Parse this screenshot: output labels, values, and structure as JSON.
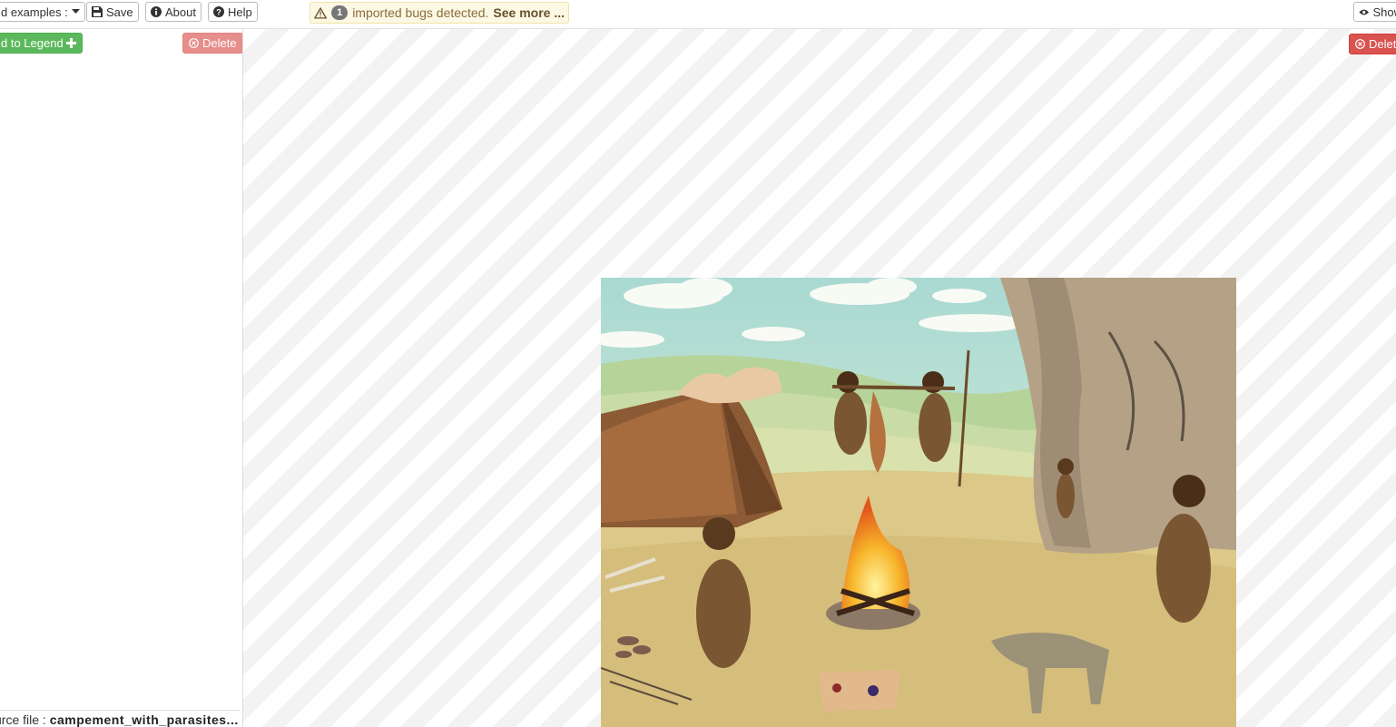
{
  "toolbar": {
    "examples_label": "d examples :",
    "save_label": "Save",
    "about_label": "About",
    "help_label": "Help",
    "show_label": "Show"
  },
  "alert": {
    "count": "1",
    "message": "imported bugs detected.",
    "link": "See more ..."
  },
  "sidebar": {
    "add_legend_label": "d to Legend",
    "delete_label": "Delete",
    "source_label": "urce file :",
    "source_file": "campement_with_parasites..."
  },
  "canvas": {
    "delete_label": "Delete"
  },
  "colors": {
    "success": "#5cb85c",
    "danger": "#d9534f",
    "warning_bg": "#fcf8e3"
  }
}
